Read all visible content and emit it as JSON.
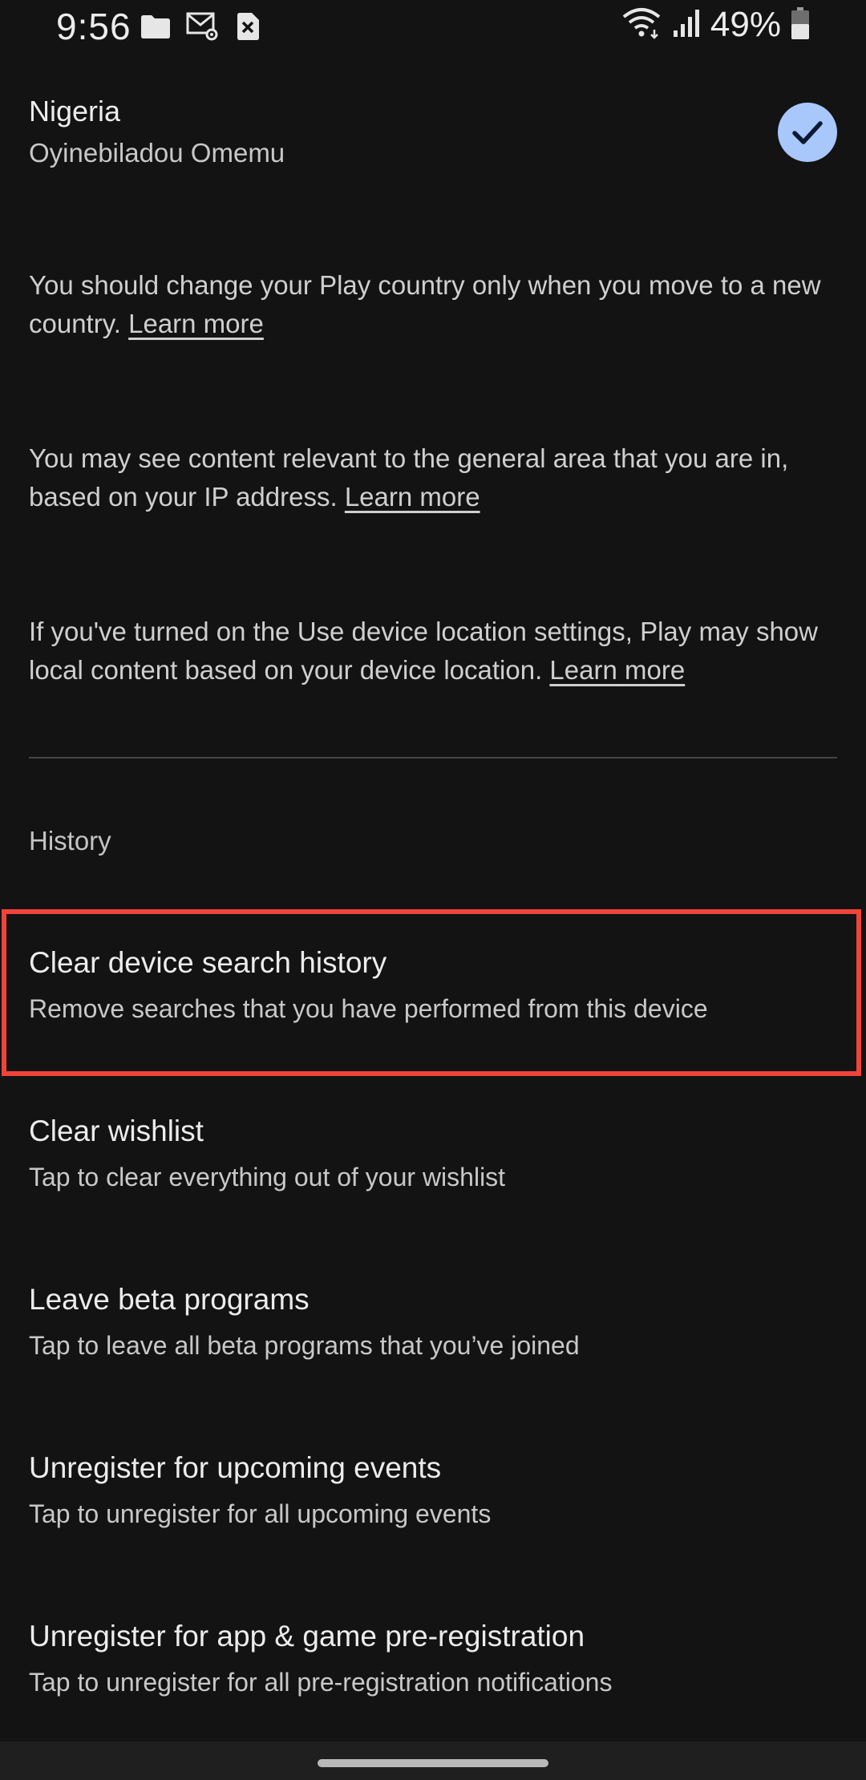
{
  "status_bar": {
    "time": "9:56",
    "left_icons": [
      "folder-icon",
      "mail-settings-icon",
      "close-box-icon"
    ],
    "right_icons": [
      "wifi-icon",
      "signal-icon",
      "battery-icon"
    ],
    "battery": "49%"
  },
  "country": {
    "name": "Nigeria",
    "account": "Oyinebiladou Omemu",
    "selected": true,
    "check_color": "#a8c7fa"
  },
  "info": [
    {
      "text": "You should change your Play country only when you move to a new country. ",
      "link": "Learn more"
    },
    {
      "text": "You may see content relevant to the general area that you are in, based on your IP address. ",
      "link": "Learn more"
    },
    {
      "text": "If you've turned on the Use device location settings, Play may show local content based on your device location. ",
      "link": "Learn more"
    }
  ],
  "history": {
    "heading": "History",
    "items": [
      {
        "title": "Clear device search history",
        "subtitle": "Remove searches that you have performed from this device",
        "highlighted": true
      },
      {
        "title": "Clear wishlist",
        "subtitle": "Tap to clear everything out of your wishlist"
      },
      {
        "title": "Leave beta programs",
        "subtitle": "Tap to leave all beta programs that you’ve joined"
      },
      {
        "title": "Unregister for upcoming events",
        "subtitle": "Tap to unregister for all upcoming events"
      },
      {
        "title": "Unregister for app & game pre-registration",
        "subtitle": "Tap to unregister for all pre-registration notifications"
      }
    ]
  },
  "colors": {
    "background": "#131313",
    "highlight_border": "#f0443a"
  }
}
